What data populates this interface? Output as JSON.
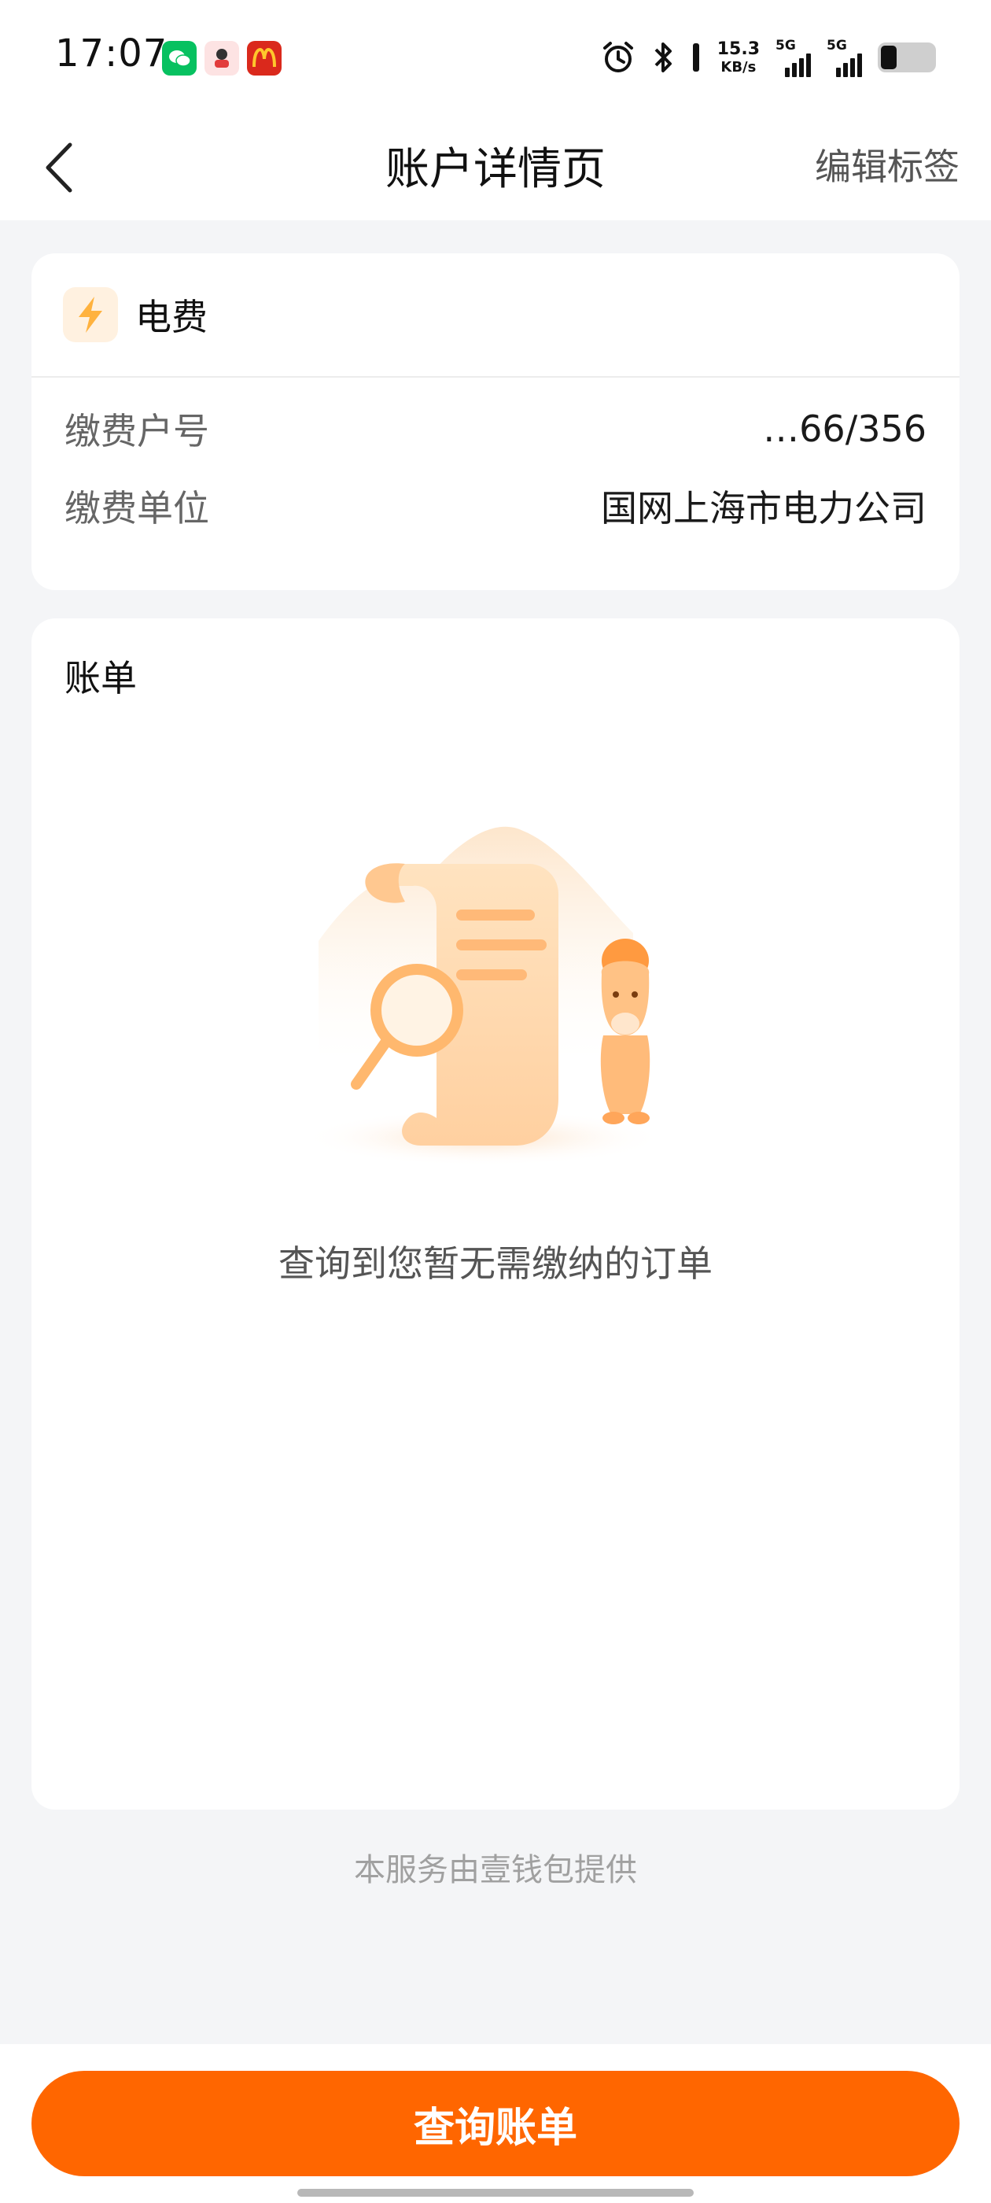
{
  "status_bar": {
    "time": "17:07",
    "app_icons": [
      "wechat-icon",
      "live-app-icon",
      "mcdonalds-icon"
    ],
    "network_speed_value": "15.3",
    "network_speed_unit": "KB/s",
    "sim1_label": "5G",
    "sim2_label": "5G",
    "battery_level": 0.3
  },
  "nav": {
    "title": "账户详情页",
    "action": "编辑标签"
  },
  "account": {
    "category": "电费",
    "rows": [
      {
        "label": "缴费户号",
        "value": "…66/356"
      },
      {
        "label": "缴费单位",
        "value": "国网上海市电力公司"
      }
    ]
  },
  "bill": {
    "title": "账单",
    "empty_text": "查询到您暂无需缴纳的订单"
  },
  "footer_note": "本服务由壹钱包提供",
  "bottom": {
    "query_button": "查询账单"
  },
  "colors": {
    "accent": "#ff6600",
    "background": "#f4f5f7",
    "card": "#ffffff"
  }
}
